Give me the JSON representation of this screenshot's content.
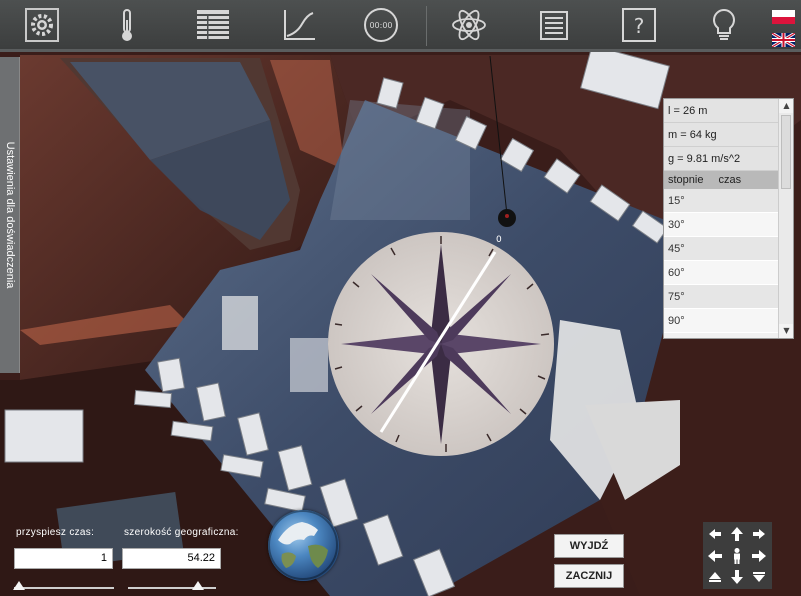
{
  "toolbar": {
    "buttons": [
      {
        "icon": "settings-gear-icon"
      },
      {
        "icon": "thermometer-icon"
      },
      {
        "icon": "table-icon"
      },
      {
        "icon": "chart-axes-icon"
      },
      {
        "icon": "stopwatch-icon",
        "text": "00:00"
      },
      {
        "icon": "atom-icon"
      },
      {
        "icon": "document-icon"
      },
      {
        "icon": "help-icon",
        "text": "?"
      },
      {
        "icon": "lightbulb-icon"
      }
    ],
    "flags": [
      "pl-flag-icon",
      "uk-flag-icon"
    ]
  },
  "side_tab": {
    "label": "Ustawienia dla doświadczenia"
  },
  "panel": {
    "params": [
      "l = 26 m",
      "m = 64 kg",
      "g = 9.81 m/s^2"
    ],
    "header": {
      "col1": "stopnie",
      "col2": "czas"
    },
    "rows": [
      "15°",
      "30°",
      "45°",
      "60°",
      "75°",
      "90°"
    ],
    "scroll_up": "▲",
    "scroll_down": "▼"
  },
  "controls": {
    "speed_label": "przyspiesz czas:",
    "speed_value": "1",
    "latitude_label": "szerokość geograficzna:",
    "latitude_value": "54.22",
    "exit_button": "WYJDŹ",
    "start_button": "ZACZNIJ"
  },
  "compass": {
    "zero_label": "0"
  },
  "colors": {
    "toolbar": "#4a4d4d",
    "floor": "#40506c",
    "wall": "#4a2520",
    "panel": "#f1f1f1"
  }
}
